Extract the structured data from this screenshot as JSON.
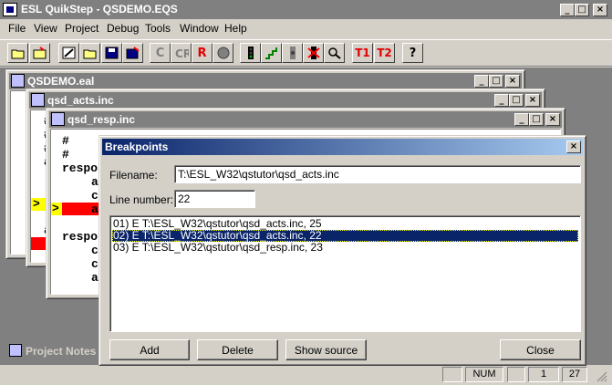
{
  "window": {
    "title": "ESL QuikStep - QSDEMO.EQS"
  },
  "menu": [
    "File",
    "View",
    "Project",
    "Debug",
    "Tools",
    "Window",
    "Help"
  ],
  "toolbar": {
    "c_label": "C",
    "r_label": "R",
    "t1_label": "T1",
    "t2_label": "T2",
    "help_label": "?"
  },
  "windows": {
    "qsdemo": {
      "title": "QSDEMO.eal"
    },
    "acts": {
      "title": "qsd_acts.inc"
    },
    "resp": {
      "title": "qsd_resp.inc"
    }
  },
  "code": {
    "back_lines": [
      "#",
      "#",
      "#",
      "a"
    ],
    "back_lines2": [
      "a"
    ],
    "resp_lines": [
      "#",
      "#",
      "respo",
      "a",
      "c",
      "a",
      "",
      "respo",
      "c",
      "c",
      "a"
    ],
    "marker": ">"
  },
  "project_notes": {
    "title": "Project Notes"
  },
  "dialog": {
    "title": "Breakpoints",
    "filename_label": "Filename:",
    "filename_value": "T:\\ESL_W32\\qstutor\\qsd_acts.inc",
    "line_label": "Line number:",
    "line_value": "22",
    "items": [
      "01) E T:\\ESL_W32\\qstutor\\qsd_acts.inc, 25",
      "02) E T:\\ESL_W32\\qstutor\\qsd_acts.inc, 22",
      "03) E T:\\ESL_W32\\qstutor\\qsd_resp.inc, 23"
    ],
    "selected_index": 1,
    "buttons": {
      "add": "Add",
      "delete": "Delete",
      "show_source": "Show source",
      "close": "Close"
    }
  },
  "caption_glyphs": {
    "minimize": "_",
    "maximize": "□",
    "close": "×"
  },
  "status": {
    "num": "NUM",
    "line": "1",
    "col": "27"
  },
  "colors": {
    "selection": "#0a246a",
    "breakpoint": "#ff0000",
    "marker": "#ffff00"
  }
}
